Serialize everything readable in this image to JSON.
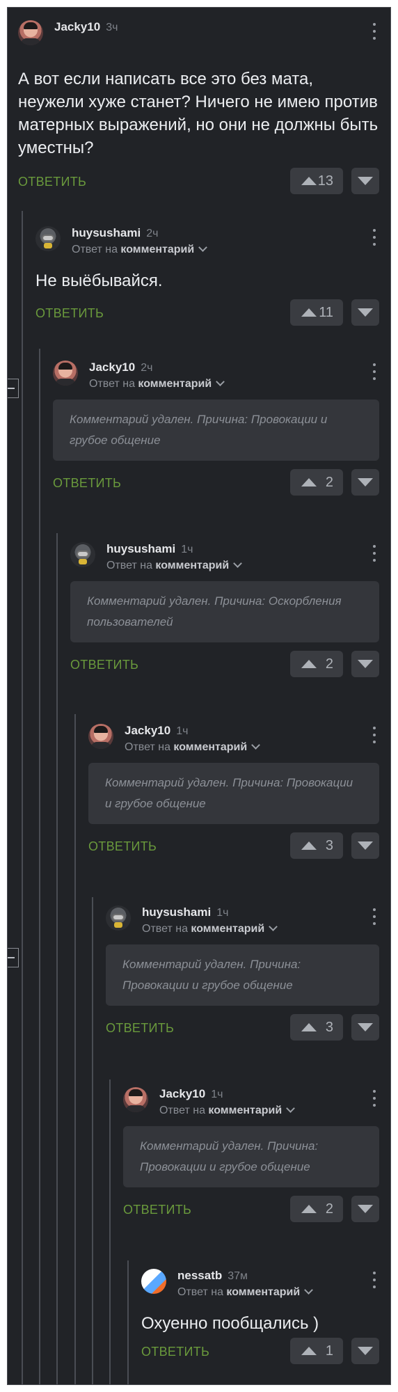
{
  "comments": [
    {
      "user": "Jacky10",
      "time": "3ч",
      "text": "А вот если написать все это без мата, неужели хуже станет? Ничего не имею против матерных выражений, но они не должны быть уместны?",
      "reply_label": "ОТВЕТИТЬ",
      "votes": "13"
    },
    {
      "user": "huysushami",
      "time": "2ч",
      "reply_prefix": "Ответ на",
      "reply_target": "комментарий",
      "text": "Не выёбывайся.",
      "reply_label": "ОТВЕТИТЬ",
      "votes": "11"
    },
    {
      "user": "Jacky10",
      "time": "2ч",
      "reply_prefix": "Ответ на",
      "reply_target": "комментарий",
      "deleted": "Комментарий удален. Причина: Провокации и грубое общение",
      "reply_label": "ОТВЕТИТЬ",
      "votes": "2"
    },
    {
      "user": "huysushami",
      "time": "1ч",
      "reply_prefix": "Ответ на",
      "reply_target": "комментарий",
      "deleted": "Комментарий удален. Причина: Оскорбления пользователей",
      "reply_label": "ОТВЕТИТЬ",
      "votes": "2"
    },
    {
      "user": "Jacky10",
      "time": "1ч",
      "reply_prefix": "Ответ на",
      "reply_target": "комментарий",
      "deleted": "Комментарий удален. Причина: Провокации и грубое общение",
      "reply_label": "ОТВЕТИТЬ",
      "votes": "3"
    },
    {
      "user": "huysushami",
      "time": "1ч",
      "reply_prefix": "Ответ на",
      "reply_target": "комментарий",
      "deleted": "Комментарий удален. Причина: Провокации и грубое общение",
      "reply_label": "ОТВЕТИТЬ",
      "votes": "3"
    },
    {
      "user": "Jacky10",
      "time": "1ч",
      "reply_prefix": "Ответ на",
      "reply_target": "комментарий",
      "deleted": "Комментарий удален. Причина: Провокации и грубое общение",
      "reply_label": "ОТВЕТИТЬ",
      "votes": "2"
    },
    {
      "user": "nessatb",
      "time": "37м",
      "reply_prefix": "Ответ на",
      "reply_target": "комментарий",
      "text": "Охуенно пообщались )",
      "reply_label": "ОТВЕТИТЬ",
      "votes": "1"
    }
  ],
  "colors": {
    "background": "#212327",
    "reply_link": "#6a9a3c",
    "deleted_box": "#34363b"
  },
  "icons": {
    "upvote": "triangle-up-icon",
    "downvote": "triangle-down-icon",
    "menu": "more-vertical-icon",
    "expand": "chevron-down-icon",
    "collapse": "minus-icon"
  }
}
